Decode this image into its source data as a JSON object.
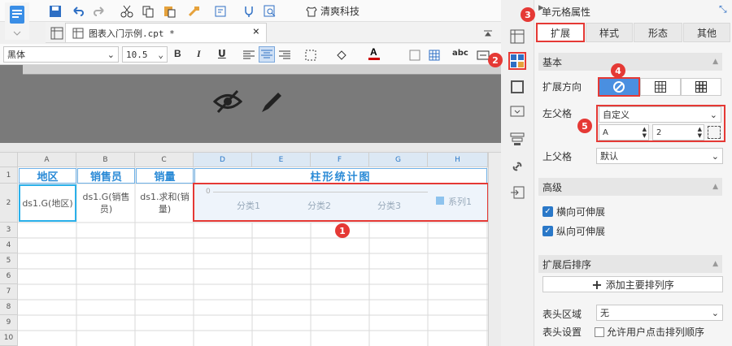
{
  "toolbar": {
    "company_label": "清爽科技"
  },
  "tab": {
    "title": "图表入门示例.cpt *"
  },
  "format": {
    "font": "黑体",
    "size": "10.5"
  },
  "grid": {
    "columns": [
      "A",
      "B",
      "C",
      "D",
      "E",
      "F",
      "G",
      "H"
    ],
    "rows": [
      "1",
      "2",
      "3",
      "4",
      "5",
      "6",
      "7",
      "8",
      "9",
      "10"
    ],
    "header": {
      "a": "地区",
      "b": "销售员",
      "c": "销量",
      "chart": "柱形统计图"
    },
    "data": {
      "a": "ds1.G(地区)",
      "b": "ds1.G(销售员)",
      "c": "ds1.求和(销量)"
    },
    "chart": {
      "tick": "0",
      "categories": [
        "分类1",
        "分类2",
        "分类3"
      ],
      "legend": "系列1"
    }
  },
  "panel": {
    "title": "单元格属性",
    "tabs": [
      "扩展",
      "样式",
      "形态",
      "其他"
    ],
    "basic": "基本",
    "expand_dir": "扩展方向",
    "left_parent": "左父格",
    "left_parent_value": "自定义",
    "lp_col": "A",
    "lp_row": "2",
    "up_parent": "上父格",
    "up_parent_value": "默认",
    "advanced": "高级",
    "h_expand": "横向可伸展",
    "v_expand": "纵向可伸展",
    "sort": "扩展后排序",
    "add_sort": "添加主要排列序",
    "header_area": "表头区域",
    "header_area_value": "无",
    "header_set": "表头设置",
    "allow_sort": "允许用户点击排列顺序"
  },
  "badges": [
    "1",
    "2",
    "3",
    "4",
    "5"
  ],
  "colors": {
    "accent": "#2a8ad6",
    "badge": "#e53935"
  }
}
